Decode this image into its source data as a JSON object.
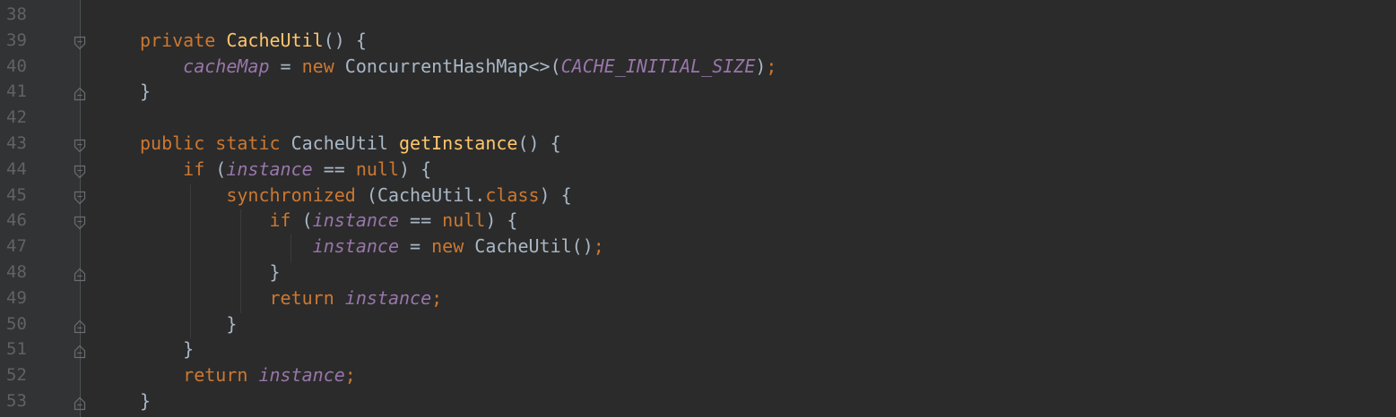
{
  "editor": {
    "colors": {
      "background": "#2b2b2b",
      "gutter": "#313335",
      "line_number": "#606366",
      "keyword": "#cc7832",
      "method": "#ffc66d",
      "field": "#9876aa",
      "text": "#a9b7c6"
    },
    "lines": [
      {
        "num": "38",
        "fold": "",
        "segments": []
      },
      {
        "num": "39",
        "fold": "open",
        "segments": [
          {
            "t": "private ",
            "c": "kw"
          },
          {
            "t": "CacheUtil",
            "c": "fn"
          },
          {
            "t": "() {",
            "c": "tx"
          }
        ]
      },
      {
        "num": "40",
        "fold": "",
        "segments": [
          {
            "t": "    ",
            "c": "tx"
          },
          {
            "t": "cacheMap",
            "c": "fld"
          },
          {
            "t": " = ",
            "c": "tx"
          },
          {
            "t": "new ",
            "c": "kw"
          },
          {
            "t": "ConcurrentHashMap<>(",
            "c": "tx"
          },
          {
            "t": "CACHE_INITIAL_SIZE",
            "c": "fld"
          },
          {
            "t": ")",
            "c": "tx"
          },
          {
            "t": ";",
            "c": "kw"
          }
        ]
      },
      {
        "num": "41",
        "fold": "close",
        "segments": [
          {
            "t": "}",
            "c": "tx"
          }
        ]
      },
      {
        "num": "42",
        "fold": "",
        "segments": []
      },
      {
        "num": "43",
        "fold": "open",
        "segments": [
          {
            "t": "public static ",
            "c": "kw"
          },
          {
            "t": "CacheUtil ",
            "c": "tx"
          },
          {
            "t": "getInstance",
            "c": "fn"
          },
          {
            "t": "() {",
            "c": "tx"
          }
        ]
      },
      {
        "num": "44",
        "fold": "open",
        "segments": [
          {
            "t": "    ",
            "c": "tx"
          },
          {
            "t": "if ",
            "c": "kw"
          },
          {
            "t": "(",
            "c": "tx"
          },
          {
            "t": "instance",
            "c": "fld"
          },
          {
            "t": " == ",
            "c": "tx"
          },
          {
            "t": "null",
            "c": "kw"
          },
          {
            "t": ") {",
            "c": "tx"
          }
        ]
      },
      {
        "num": "45",
        "fold": "open",
        "segments": [
          {
            "t": "        ",
            "c": "tx"
          },
          {
            "t": "synchronized ",
            "c": "kw"
          },
          {
            "t": "(CacheUtil.",
            "c": "tx"
          },
          {
            "t": "class",
            "c": "kw"
          },
          {
            "t": ") {",
            "c": "tx"
          }
        ]
      },
      {
        "num": "46",
        "fold": "open",
        "segments": [
          {
            "t": "            ",
            "c": "tx"
          },
          {
            "t": "if ",
            "c": "kw"
          },
          {
            "t": "(",
            "c": "tx"
          },
          {
            "t": "instance",
            "c": "fld"
          },
          {
            "t": " == ",
            "c": "tx"
          },
          {
            "t": "null",
            "c": "kw"
          },
          {
            "t": ") {",
            "c": "tx"
          }
        ]
      },
      {
        "num": "47",
        "fold": "",
        "segments": [
          {
            "t": "                ",
            "c": "tx"
          },
          {
            "t": "instance",
            "c": "fld"
          },
          {
            "t": " = ",
            "c": "tx"
          },
          {
            "t": "new ",
            "c": "kw"
          },
          {
            "t": "CacheUtil()",
            "c": "tx"
          },
          {
            "t": ";",
            "c": "kw"
          }
        ]
      },
      {
        "num": "48",
        "fold": "close",
        "segments": [
          {
            "t": "            }",
            "c": "tx"
          }
        ]
      },
      {
        "num": "49",
        "fold": "",
        "segments": [
          {
            "t": "            ",
            "c": "tx"
          },
          {
            "t": "return ",
            "c": "kw"
          },
          {
            "t": "instance",
            "c": "fld"
          },
          {
            "t": ";",
            "c": "kw"
          }
        ]
      },
      {
        "num": "50",
        "fold": "close",
        "segments": [
          {
            "t": "        }",
            "c": "tx"
          }
        ]
      },
      {
        "num": "51",
        "fold": "close",
        "segments": [
          {
            "t": "    }",
            "c": "tx"
          }
        ]
      },
      {
        "num": "52",
        "fold": "",
        "segments": [
          {
            "t": "    ",
            "c": "tx"
          },
          {
            "t": "return ",
            "c": "kw"
          },
          {
            "t": "instance",
            "c": "fld"
          },
          {
            "t": ";",
            "c": "kw"
          }
        ]
      },
      {
        "num": "53",
        "fold": "close",
        "segments": [
          {
            "t": "}",
            "c": "tx"
          }
        ]
      }
    ]
  }
}
